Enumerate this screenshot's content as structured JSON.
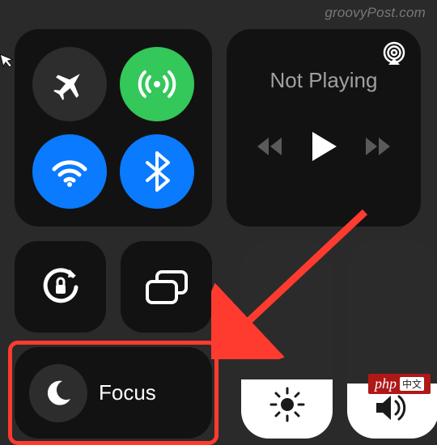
{
  "watermark": "groovyPost.com",
  "connectivity": {
    "airplane": {
      "name": "airplane-mode",
      "active": false,
      "bg": "#2d2d2d"
    },
    "cellular": {
      "name": "cellular-data",
      "active": true,
      "bg": "#34c759"
    },
    "wifi": {
      "name": "wifi",
      "active": true,
      "bg": "#0a7aff"
    },
    "bluetooth": {
      "name": "bluetooth",
      "active": true,
      "bg": "#0a7aff"
    }
  },
  "media": {
    "status": "Not Playing",
    "airplay_icon": "airplay-icon"
  },
  "row2": {
    "orientation_lock": "orientation-lock",
    "screen_mirroring": "screen-mirroring"
  },
  "focus": {
    "label": "Focus",
    "icon": "moon-icon"
  },
  "sliders": {
    "brightness": {
      "value_pct": 30,
      "icon": "brightness-icon"
    },
    "volume": {
      "value_pct": 28,
      "icon": "volume-icon"
    }
  },
  "php_badge": {
    "text": "php",
    "cn": "中文"
  }
}
